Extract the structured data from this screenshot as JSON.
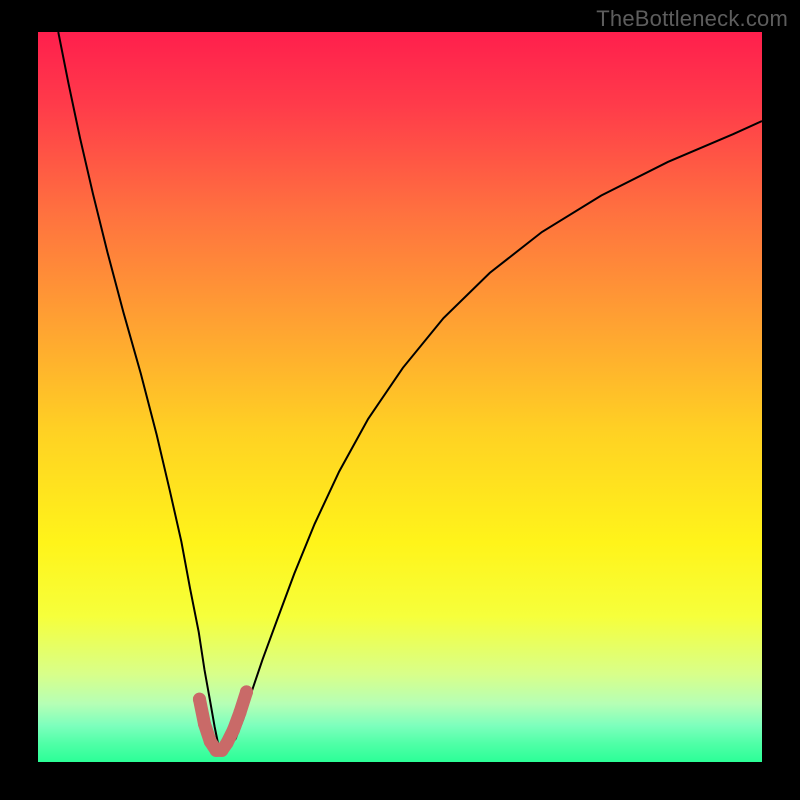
{
  "watermark": "TheBottleneck.com",
  "chart_data": {
    "type": "line",
    "title": "",
    "xlabel": "",
    "ylabel": "",
    "xlim": [
      0,
      100
    ],
    "ylim": [
      0,
      100
    ],
    "gradient_stops": [
      {
        "offset": 0.0,
        "color": "#ff1f4d"
      },
      {
        "offset": 0.1,
        "color": "#ff3b4a"
      },
      {
        "offset": 0.25,
        "color": "#ff723f"
      },
      {
        "offset": 0.4,
        "color": "#ffa232"
      },
      {
        "offset": 0.55,
        "color": "#ffd223"
      },
      {
        "offset": 0.7,
        "color": "#fff41a"
      },
      {
        "offset": 0.8,
        "color": "#f6ff3b"
      },
      {
        "offset": 0.88,
        "color": "#d8ff8a"
      },
      {
        "offset": 0.92,
        "color": "#b6ffb5"
      },
      {
        "offset": 0.95,
        "color": "#7dffbd"
      },
      {
        "offset": 0.975,
        "color": "#4fffa7"
      },
      {
        "offset": 1.0,
        "color": "#2bff97"
      }
    ],
    "series": [
      {
        "name": "bottleneck-curve",
        "stroke": "#000000",
        "stroke_width": 2,
        "x": [
          2.8,
          4.2,
          5.8,
          7.6,
          9.6,
          11.8,
          14.2,
          16.4,
          18.2,
          19.8,
          21.0,
          22.2,
          23.0,
          23.8,
          24.4,
          24.9,
          25.3,
          26.0,
          27.3,
          28.4,
          29.5,
          31.0,
          33.0,
          35.4,
          38.2,
          41.6,
          45.6,
          50.4,
          56.0,
          62.4,
          69.6,
          77.8,
          87.0,
          96.0,
          100.0
        ],
        "y": [
          100.0,
          93.0,
          85.5,
          77.8,
          69.8,
          61.6,
          53.2,
          44.8,
          37.2,
          30.2,
          23.8,
          17.8,
          12.6,
          8.2,
          4.8,
          2.4,
          1.2,
          1.6,
          3.2,
          6.0,
          9.6,
          14.0,
          19.4,
          25.8,
          32.6,
          39.8,
          47.0,
          54.0,
          60.8,
          67.0,
          72.6,
          77.6,
          82.2,
          86.0,
          87.8
        ]
      },
      {
        "name": "sweet-spot-marker",
        "stroke": "#c96a68",
        "stroke_width": 13,
        "linecap": "round",
        "dots": true,
        "x": [
          22.3,
          23.0,
          23.8,
          24.6,
          25.4,
          26.1,
          27.0,
          27.9,
          28.8
        ],
        "y": [
          8.6,
          5.2,
          2.8,
          1.6,
          1.6,
          2.6,
          4.4,
          6.8,
          9.6
        ]
      }
    ]
  }
}
